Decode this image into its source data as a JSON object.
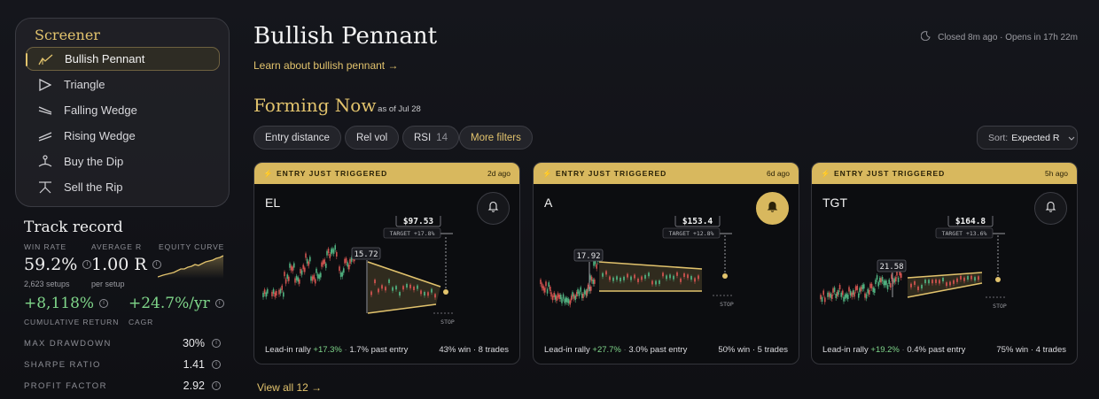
{
  "sidebar": {
    "title": "Screener",
    "items": [
      {
        "label": "Bullish Pennant",
        "icon": "pennant-icon",
        "active": true
      },
      {
        "label": "Triangle",
        "icon": "triangle-icon"
      },
      {
        "label": "Falling Wedge",
        "icon": "falling-wedge-icon"
      },
      {
        "label": "Rising Wedge",
        "icon": "rising-wedge-icon"
      },
      {
        "label": "Buy the Dip",
        "icon": "buy-dip-icon"
      },
      {
        "label": "Sell the Rip",
        "icon": "sell-rip-icon"
      }
    ]
  },
  "track": {
    "title": "Track record",
    "win_rate_label": "WIN RATE",
    "win_rate": "59.2%",
    "setups": "2,623 setups",
    "avg_r_label": "AVERAGE R",
    "avg_r": "1.00 R",
    "per_setup": "per setup",
    "equity_label": "EQUITY CURVE",
    "cum_return": "+8,118%",
    "cum_return_label": "CUMULATIVE RETURN",
    "cagr": "+24.7%/yr",
    "cagr_label": "CAGR",
    "rows": [
      {
        "label": "MAX DRAWDOWN",
        "value": "30%"
      },
      {
        "label": "SHARPE RATIO",
        "value": "1.41"
      },
      {
        "label": "PROFIT FACTOR",
        "value": "2.92"
      }
    ]
  },
  "header": {
    "title": "Bullish Pennant",
    "learn": "Learn about bullish pennant →",
    "status": "Closed 8m ago · Opens in 17h 22m"
  },
  "section": {
    "title": "Forming Now",
    "as_of": "as of Jul 28"
  },
  "filters": {
    "entry": "Entry distance",
    "relvol": "Rel vol",
    "rsi": "RSI",
    "rsi_value": "14",
    "more": "More filters",
    "sort_prefix": "Sort:",
    "sort_value": "Expected R"
  },
  "cards": [
    {
      "banner": "ENTRY JUST TRIGGERED",
      "ago": "2d ago",
      "ticker": "EL",
      "alert_on": false,
      "price": "$97.53",
      "target": "TARGET +17.8%",
      "base": "15.72",
      "stop": "STOP",
      "leadin_label": "Lead-in rally",
      "leadin": "+17.3%",
      "past": "1.7% past entry",
      "stats": "43% win · 8 trades"
    },
    {
      "banner": "ENTRY JUST TRIGGERED",
      "ago": "6d ago",
      "ticker": "A",
      "alert_on": true,
      "price": "$153.4",
      "target": "TARGET +12.8%",
      "base": "17.92",
      "stop": "STOP",
      "leadin_label": "Lead-in rally",
      "leadin": "+27.7%",
      "past": "3.0% past entry",
      "stats": "50% win · 5 trades"
    },
    {
      "banner": "ENTRY JUST TRIGGERED",
      "ago": "5h ago",
      "ticker": "TGT",
      "alert_on": false,
      "price": "$164.8",
      "target": "TARGET +13.6%",
      "base": "21.58",
      "stop": "STOP",
      "leadin_label": "Lead-in rally",
      "leadin": "+19.2%",
      "past": "0.4% past entry",
      "stats": "75% win · 4 trades"
    }
  ],
  "view_all": "View all 12 →",
  "colors": {
    "accent": "#e2c36d",
    "up": "#4fae7e",
    "down": "#d0534f",
    "positive": "#7fd68a"
  }
}
